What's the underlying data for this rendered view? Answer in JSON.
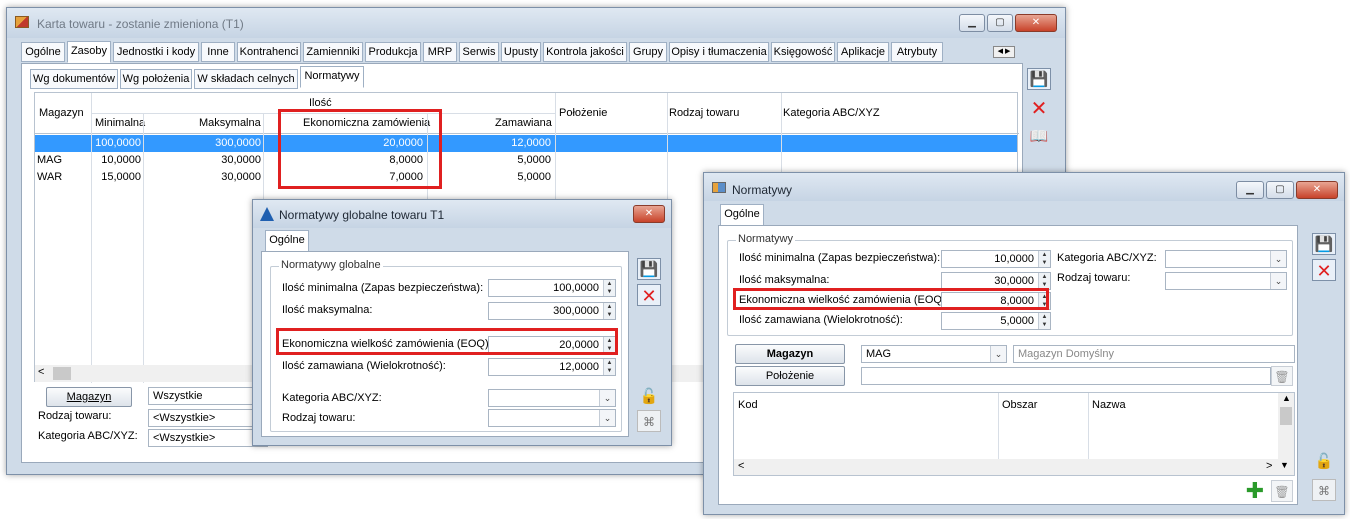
{
  "main_window": {
    "title": "Karta towaru - zostanie zmieniona (T1)",
    "tabs": [
      "Ogólne",
      "Zasoby",
      "Jednostki i kody",
      "Inne",
      "Kontrahenci",
      "Zamienniki",
      "Produkcja",
      "MRP",
      "Serwis",
      "Upusty",
      "Kontrola jakości",
      "Grupy",
      "Opisy i tłumaczenia",
      "Księgowość",
      "Aplikacje",
      "Atrybuty"
    ],
    "active_tab": "Zasoby",
    "subtabs": [
      "Wg dokumentów",
      "Wg położenia",
      "W składach celnych",
      "Normatywy"
    ],
    "active_subtab": "Normatywy",
    "grid": {
      "group_header": "Ilość",
      "headers": {
        "magazyn": "Magazyn",
        "minimalna": "Minimalna",
        "maksymalna": "Maksymalna",
        "ekonomiczna": "Ekonomiczna zamówienia",
        "zamawiana": "Zamawiana",
        "polozenie": "Położenie",
        "rodzaj": "Rodzaj towaru",
        "kategoria": "Kategoria ABC/XYZ"
      },
      "rows": [
        {
          "magazyn": "",
          "min": "100,0000",
          "max": "300,0000",
          "eoq": "20,0000",
          "zam": "12,0000"
        },
        {
          "magazyn": "MAG",
          "min": "10,0000",
          "max": "30,0000",
          "eoq": "8,0000",
          "zam": "5,0000"
        },
        {
          "magazyn": "WAR",
          "min": "15,0000",
          "max": "30,0000",
          "eoq": "7,0000",
          "zam": "5,0000"
        }
      ]
    },
    "filters": {
      "magazyn_button": "Magazyn",
      "magazyn_value": "Wszystkie",
      "rodzaj_label": "Rodzaj towaru:",
      "rodzaj_value": "<Wszystkie>",
      "kategoria_label": "Kategoria ABC/XYZ:",
      "kategoria_value": "<Wszystkie>"
    }
  },
  "global_dialog": {
    "title": "Normatywy globalne towaru T1",
    "tab": "Ogólne",
    "group_title": "Normatywy globalne",
    "fields": {
      "min_label": "Ilość minimalna (Zapas bezpieczeństwa):",
      "min_value": "100,0000",
      "max_label": "Ilość maksymalna:",
      "max_value": "300,0000",
      "eoq_label": "Ekonomiczna wielkość zamówienia (EOQ):",
      "eoq_value": "20,0000",
      "zam_label": "Ilość zamawiana (Wielokrotność):",
      "zam_value": "12,0000",
      "kategoria_label": "Kategoria ABC/XYZ:",
      "rodzaj_label": "Rodzaj towaru:"
    }
  },
  "normatywy_dialog": {
    "title": "Normatywy",
    "tab": "Ogólne",
    "group_title": "Normatywy",
    "fields": {
      "min_label": "Ilość minimalna (Zapas bezpieczeństwa):",
      "min_value": "10,0000",
      "max_label": "Ilość maksymalna:",
      "max_value": "30,0000",
      "eoq_label": "Ekonomiczna wielkość zamówienia (EOQ):",
      "eoq_value": "8,0000",
      "zam_label": "Ilość zamawiana (Wielokrotność):",
      "zam_value": "5,0000",
      "kategoria_label": "Kategoria ABC/XYZ:",
      "rodzaj_label": "Rodzaj towaru:"
    },
    "magazyn_button": "Magazyn",
    "magazyn_value": "MAG",
    "magazyn_name": "Magazyn Domyślny",
    "polozenie_button": "Położenie",
    "list_headers": {
      "kod": "Kod",
      "obszar": "Obszar",
      "nazwa": "Nazwa"
    }
  },
  "colors": {
    "highlight": "#e02020",
    "selection": "#3399ff"
  }
}
